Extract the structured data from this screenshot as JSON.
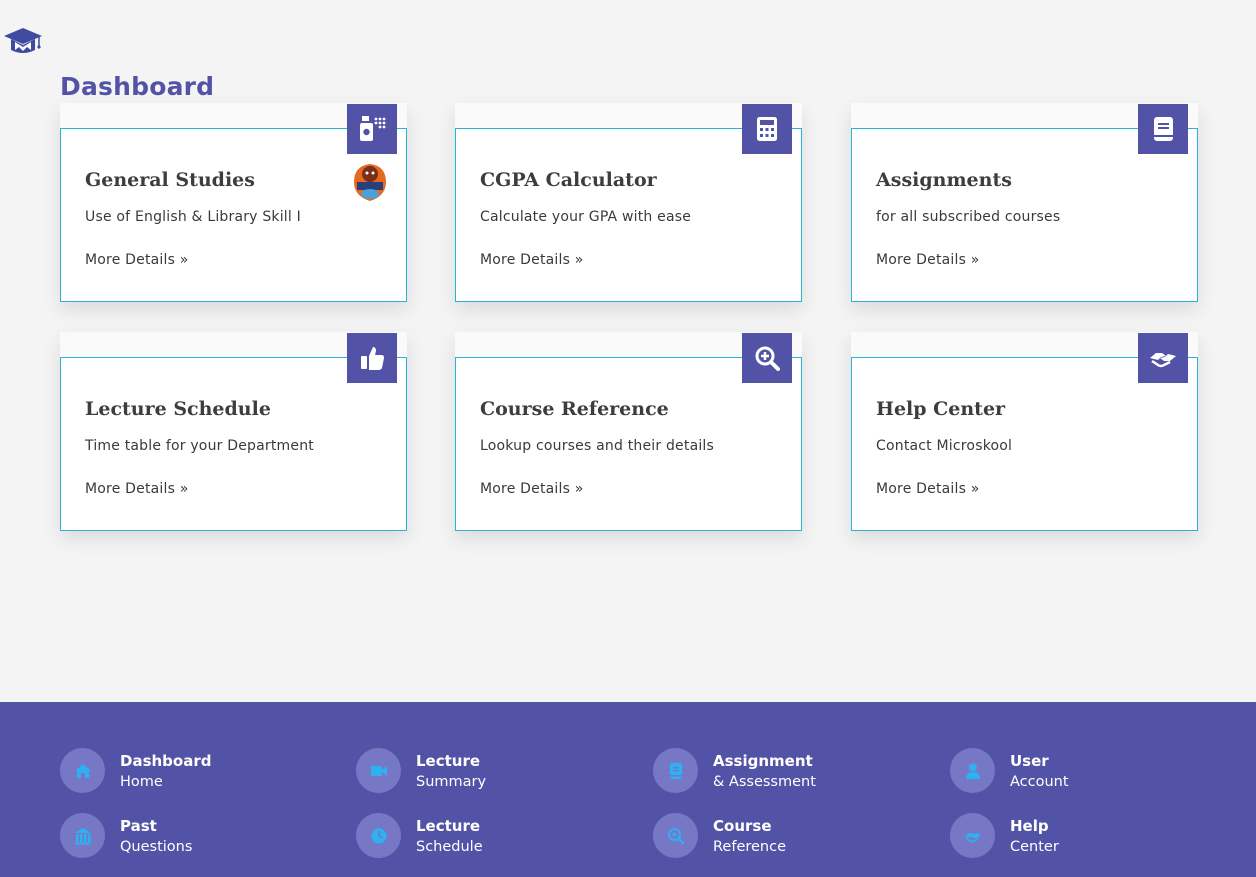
{
  "page": {
    "title": "Dashboard",
    "accent": "#5253a7",
    "card_border": "#2cb2d6",
    "footer_icon": "#2cb2f0"
  },
  "cards": [
    {
      "title": "General Studies",
      "desc": "Use of English & Library Skill I",
      "link": "More Details »",
      "icon": "perfume-bottle-icon"
    },
    {
      "title": "CGPA Calculator",
      "desc": "Calculate your GPA with ease",
      "link": "More Details »",
      "icon": "calculator-icon"
    },
    {
      "title": "Assignments",
      "desc": "for all subscribed courses",
      "link": "More Details »",
      "icon": "book-icon"
    },
    {
      "title": "Lecture Schedule",
      "desc": "Time table for your Department",
      "link": "More Details »",
      "icon": "thumbs-up-icon"
    },
    {
      "title": "Course Reference",
      "desc": "Lookup courses and their details",
      "link": "More Details »",
      "icon": "search-plus-icon"
    },
    {
      "title": "Help Center",
      "desc": "Contact Microskool",
      "link": "More Details »",
      "icon": "handshake-icon"
    }
  ],
  "footer": {
    "items": [
      {
        "title": "Dashboard",
        "sub": "Home",
        "icon": "home-icon"
      },
      {
        "title": "Lecture",
        "sub": "Summary",
        "icon": "video-camera-icon"
      },
      {
        "title": "Assignment",
        "sub": "& Assessment",
        "icon": "book-icon"
      },
      {
        "title": "User",
        "sub": "Account",
        "icon": "user-icon"
      },
      {
        "title": "Past",
        "sub": "Questions",
        "icon": "institution-icon"
      },
      {
        "title": "Lecture",
        "sub": "Schedule",
        "icon": "clock-icon"
      },
      {
        "title": "Course",
        "sub": "Reference",
        "icon": "search-plus-icon"
      },
      {
        "title": "Help",
        "sub": "Center",
        "icon": "handshake-icon"
      }
    ]
  }
}
